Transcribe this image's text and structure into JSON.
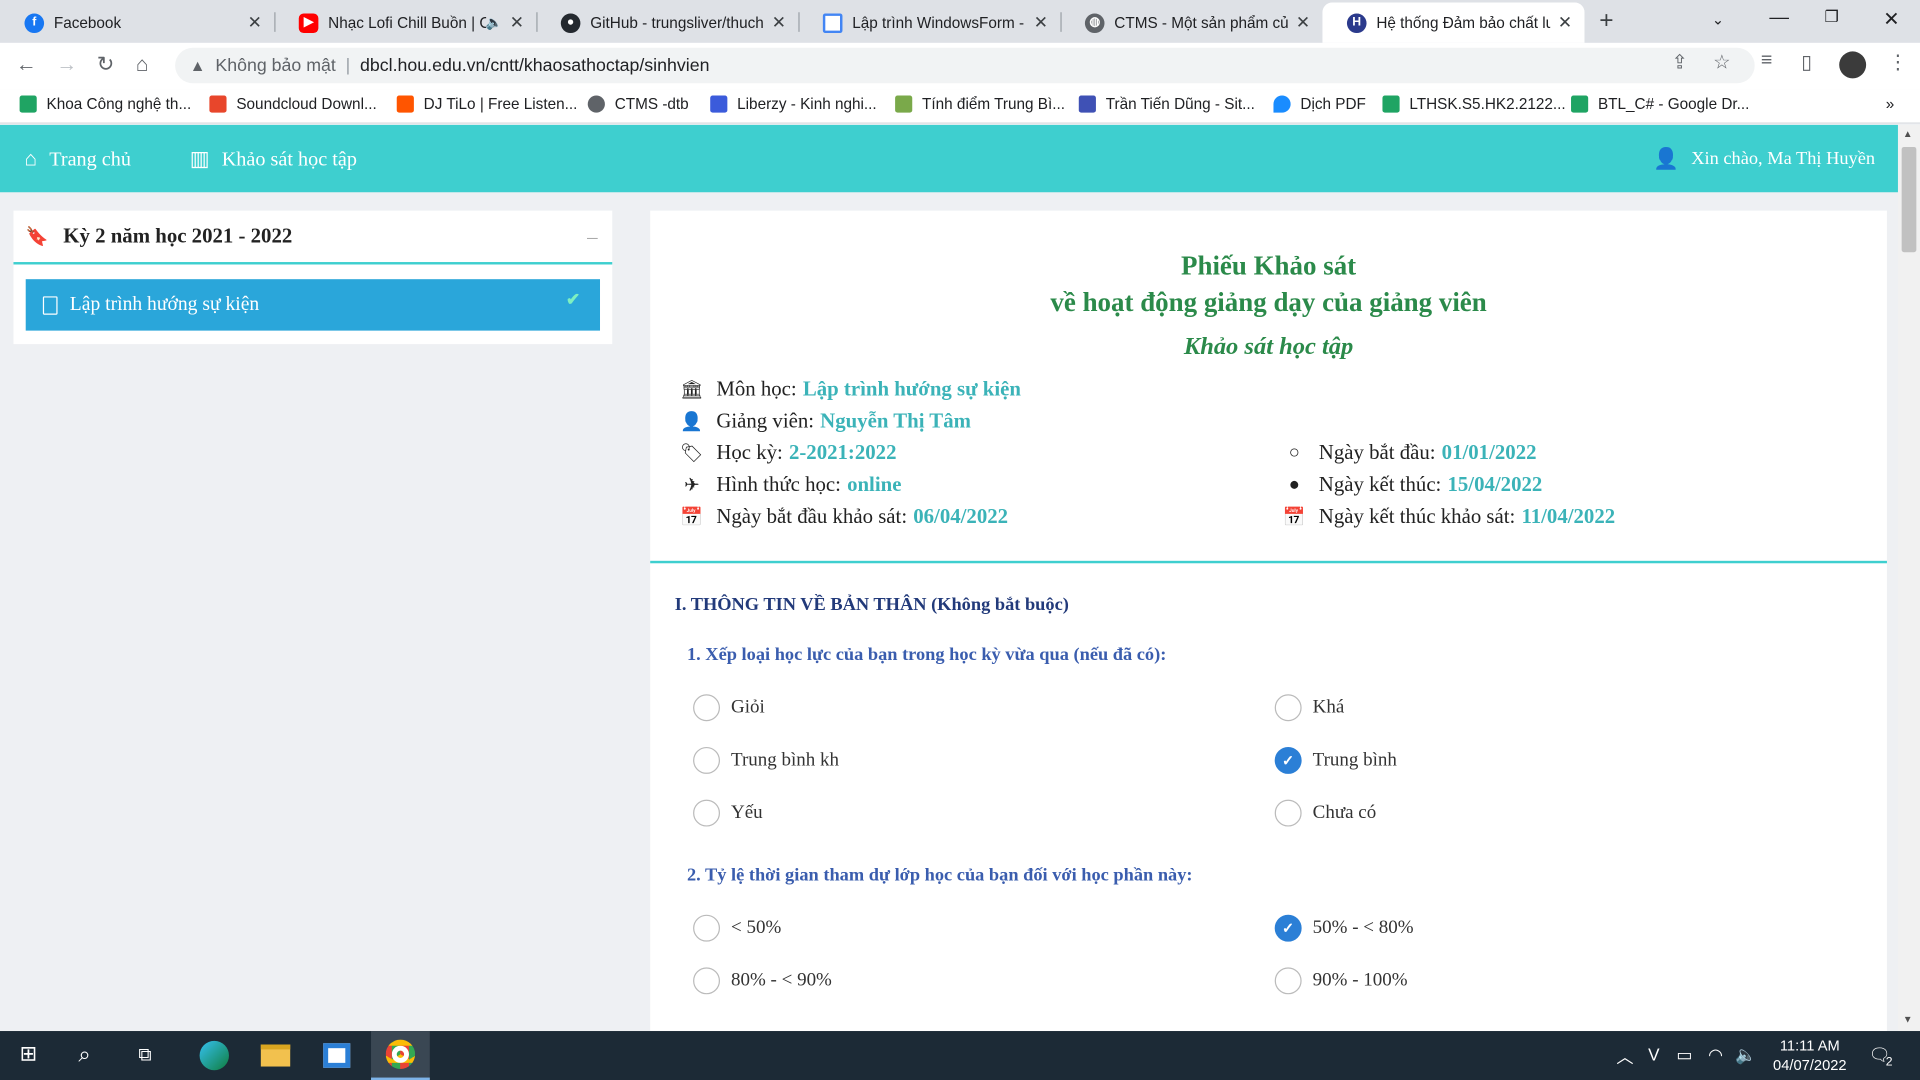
{
  "browser": {
    "tabs": [
      {
        "title": "Facebook",
        "favicon": "facebook-icon",
        "color": "#1877f2"
      },
      {
        "title": "Nhạc Lofi Chill Buồn | C",
        "favicon": "youtube-icon",
        "color": "#ff0000"
      },
      {
        "title": "GitHub - trungsliver/thucha",
        "favicon": "github-icon",
        "color": "#24292f"
      },
      {
        "title": "Lập trình WindowsForm - tạ",
        "favicon": "doc-icon",
        "color": "#4285f4"
      },
      {
        "title": "CTMS - Một sản phẩm của",
        "favicon": "globe-icon",
        "color": "#5f6368"
      },
      {
        "title": "Hệ thống Đảm bảo chất lư",
        "favicon": "hou-logo-icon",
        "color": "#2b3a8c"
      }
    ],
    "address": {
      "security_label": "Không bảo mật",
      "url": "dbcl.hou.edu.vn/cntt/khaosathoctap/sinhvien"
    },
    "bookmarks": [
      {
        "label": "Khoa Công nghệ th...",
        "icon": "google-drive-icon",
        "color": "#1fa463"
      },
      {
        "label": "Soundcloud Downl...",
        "icon": "download-icon",
        "color": "#e8462b"
      },
      {
        "label": "DJ TiLo | Free Listen...",
        "icon": "soundcloud-icon",
        "color": "#ff5500"
      },
      {
        "label": "CTMS -dtb",
        "icon": "globe-icon",
        "color": "#5f6368"
      },
      {
        "label": "Liberzy - Kinh nghi...",
        "icon": "liberzy-icon",
        "color": "#3b5bdb"
      },
      {
        "label": "Tính điểm Trung Bì...",
        "icon": "grade-icon",
        "color": "#7aa94a"
      },
      {
        "label": "Trần Tiến Dũng - Sit...",
        "icon": "site-icon",
        "color": "#3f51b5"
      },
      {
        "label": "Dịch PDF",
        "icon": "drop-icon",
        "color": "#1a8cff"
      },
      {
        "label": "LTHSK.S5.HK2.2122...",
        "icon": "google-drive-icon",
        "color": "#1fa463"
      },
      {
        "label": "BTL_C# - Google Dr...",
        "icon": "google-drive-icon",
        "color": "#1fa463"
      }
    ],
    "bookmarks_more": "»"
  },
  "site": {
    "nav": {
      "home": "Trang chủ",
      "survey": "Khảo sát học tập",
      "greeting": "Xin chào, Ma Thị Huyền"
    },
    "sidebar": {
      "term": "Kỳ 2 năm học 2021 - 2022",
      "collapse": "–",
      "course": "Lập trình hướng sự kiện"
    },
    "form": {
      "title_line1": "Phiếu Khảo sát",
      "title_line2": "về hoạt động giảng dạy của giảng viên",
      "subtitle": "Khảo sát học tập",
      "info": {
        "subject_label": "Môn học:",
        "subject_value": "Lập trình hướng sự kiện",
        "lecturer_label": "Giảng viên:",
        "lecturer_value": "Nguyễn Thị Tâm",
        "term_label": "Học kỳ:",
        "term_value": "2-2021:2022",
        "mode_label": "Hình thức học:",
        "mode_value": "online",
        "survey_start_label": "Ngày bắt đầu khảo sát:",
        "survey_start_value": "06/04/2022",
        "start_label": "Ngày bắt đầu:",
        "start_value": "01/01/2022",
        "end_label": "Ngày kết thúc:",
        "end_value": "15/04/2022",
        "survey_end_label": "Ngày kết thúc khảo sát:",
        "survey_end_value": "11/04/2022"
      },
      "section1": "I. THÔNG TIN VỀ BẢN THÂN (Không bắt buộc)",
      "q1": {
        "text": "1. Xếp loại học lực của bạn trong học kỳ vừa qua (nếu đã có):",
        "options": [
          "Giỏi",
          "Khá",
          "Trung bình kh",
          "Trung bình",
          "Yếu",
          "Chưa có"
        ],
        "selected": "Trung bình"
      },
      "q2": {
        "text": "2. Tỷ lệ thời gian tham dự lớp học của bạn đối với học phần này:",
        "options": [
          "< 50%",
          "50% - < 80%",
          "80% - < 90%",
          "90% - 100%"
        ],
        "selected": "50% - < 80%"
      }
    }
  },
  "taskbar": {
    "time": "11:11 AM",
    "date": "04/07/2022",
    "notifications": "2"
  },
  "colors": {
    "header": "#3ecfcf",
    "sidebar_active": "#2aa6da",
    "title_green": "#2b8a4a",
    "value_teal": "#3bb3b8",
    "radio_on": "#2b7fd6"
  }
}
